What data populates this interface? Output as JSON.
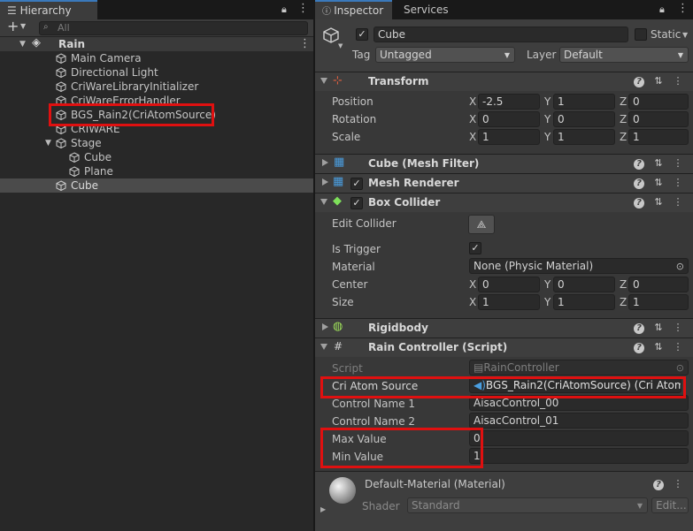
{
  "hierarchy": {
    "tab_label": "Hierarchy",
    "search_placeholder": "All",
    "add_label": "+",
    "scene": "Rain",
    "items": [
      {
        "label": "Main Camera"
      },
      {
        "label": "Directional Light"
      },
      {
        "label": "CriWareLibraryInitializer"
      },
      {
        "label": "CriWareErrorHandler"
      },
      {
        "label": "BGS_Rain2(CriAtomSource)"
      },
      {
        "label": "CRIWARE"
      },
      {
        "label": "Stage"
      },
      {
        "label": "Cube"
      },
      {
        "label": "Plane"
      },
      {
        "label": "Cube"
      }
    ]
  },
  "inspector": {
    "tabs": [
      "Inspector",
      "Services"
    ],
    "object_name": "Cube",
    "static_label": "Static",
    "tag_label": "Tag",
    "tag_value": "Untagged",
    "layer_label": "Layer",
    "layer_value": "Default",
    "transform": {
      "title": "Transform",
      "position_label": "Position",
      "rotation_label": "Rotation",
      "scale_label": "Scale",
      "axes": [
        "X",
        "Y",
        "Z"
      ],
      "position": [
        "-2.5",
        "1",
        "0"
      ],
      "rotation": [
        "0",
        "0",
        "0"
      ],
      "scale": [
        "1",
        "1",
        "1"
      ]
    },
    "mesh_filter_title": "Cube (Mesh Filter)",
    "mesh_renderer_title": "Mesh Renderer",
    "box_collider": {
      "title": "Box Collider",
      "edit_label": "Edit Collider",
      "trigger_label": "Is Trigger",
      "material_label": "Material",
      "material_value": "None (Physic Material)",
      "center_label": "Center",
      "size_label": "Size",
      "center": [
        "0",
        "0",
        "0"
      ],
      "size": [
        "1",
        "1",
        "1"
      ]
    },
    "rigidbody_title": "Rigidbody",
    "rain_controller": {
      "title": "Rain Controller (Script)",
      "script_label": "Script",
      "script_value": "RainController",
      "source_label": "Cri Atom Source",
      "source_value": "BGS_Rain2(CriAtomSource) (Cri Atom S",
      "cn1_label": "Control Name 1",
      "cn1_value": "AisacControl_00",
      "cn2_label": "Control Name 2",
      "cn2_value": "AisacControl_01",
      "max_label": "Max Value",
      "max_value": "0",
      "min_label": "Min Value",
      "min_value": "1"
    },
    "material": {
      "title": "Default-Material (Material)",
      "shader_label": "Shader",
      "shader_value": "Standard",
      "edit_label": "Edit..."
    }
  },
  "colors": {
    "highlight": "#e01010",
    "accent": "#3a79bb"
  }
}
